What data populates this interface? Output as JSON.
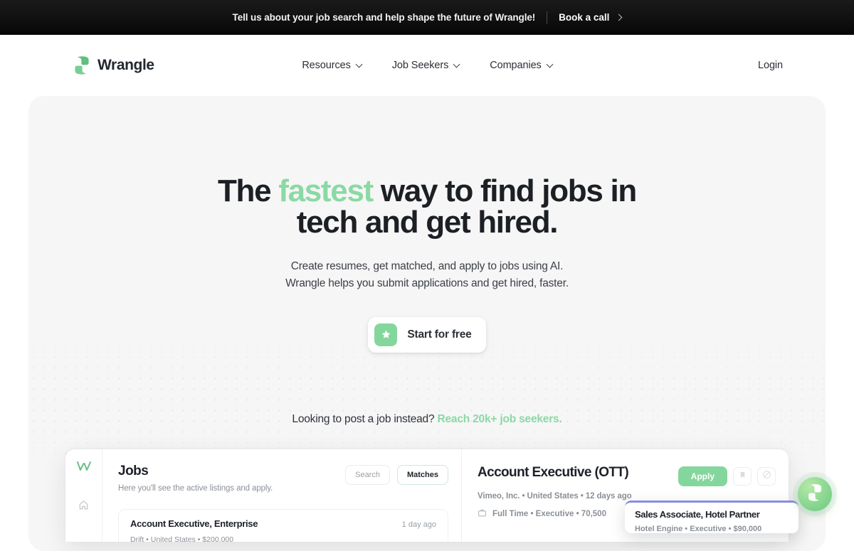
{
  "announcement": {
    "text": "Tell us about your job search and help shape the future of Wrangle!",
    "cta_label": "Book a call",
    "arrow_icon": "chevron-right-icon",
    "background": "#0d0d0d"
  },
  "header": {
    "brand": "Wrangle",
    "logo_icon": "wrangle-logo-icon",
    "nav": [
      {
        "label": "Resources",
        "caret_icon": "chevron-down-icon"
      },
      {
        "label": "Job Seekers",
        "caret_icon": "chevron-down-icon"
      },
      {
        "label": "Companies",
        "caret_icon": "chevron-down-icon"
      }
    ],
    "login_label": "Login"
  },
  "hero": {
    "headline_pre": "The ",
    "headline_accent": "fastest",
    "headline_post": " way to find jobs in",
    "headline_line2": "tech and get hired.",
    "subhead_line1": "Create resumes, get matched, and apply to jobs using AI.",
    "subhead_line2": "Wrangle helps you submit applications and get hired, faster.",
    "cta_label": "Start for free",
    "cta_icon": "star-icon",
    "post_job_text": "Looking to post a job instead? ",
    "post_job_link": "Reach 20k+ job seekers.",
    "accent_color": "#8bd9a4",
    "background": "#f6f6f6"
  },
  "mockup": {
    "rail_logo_icon": "wrangle-w-icon",
    "rail_home_icon": "home-icon",
    "title": "Jobs",
    "subtitle": "Here you'll see the active listings and apply.",
    "tabs": [
      {
        "label": "Search",
        "active": false
      },
      {
        "label": "Matches",
        "active": true
      }
    ],
    "job_list": [
      {
        "name": "Account Executive, Enterprise",
        "posted": "1 day ago",
        "meta": "Drift  •  United States  •  $200,000"
      }
    ],
    "detail": {
      "title": "Account Executive (OTT)",
      "meta": "Vimeo, Inc. • United States • 12 days ago",
      "meta2": "Full Time • Executive • 70,500",
      "briefcase_icon": "briefcase-icon",
      "apply_label": "Apply",
      "bookmark_icon": "bookmark-icon",
      "block_icon": "block-icon"
    },
    "toast": {
      "title": "Sales Associate, Hotel Partner",
      "meta": "Hotel Engine • Executive • $90,000",
      "accent": "#8a8ce0"
    }
  },
  "chat_widget": {
    "icon": "wrangle-chat-icon",
    "color": "#8fd994"
  }
}
